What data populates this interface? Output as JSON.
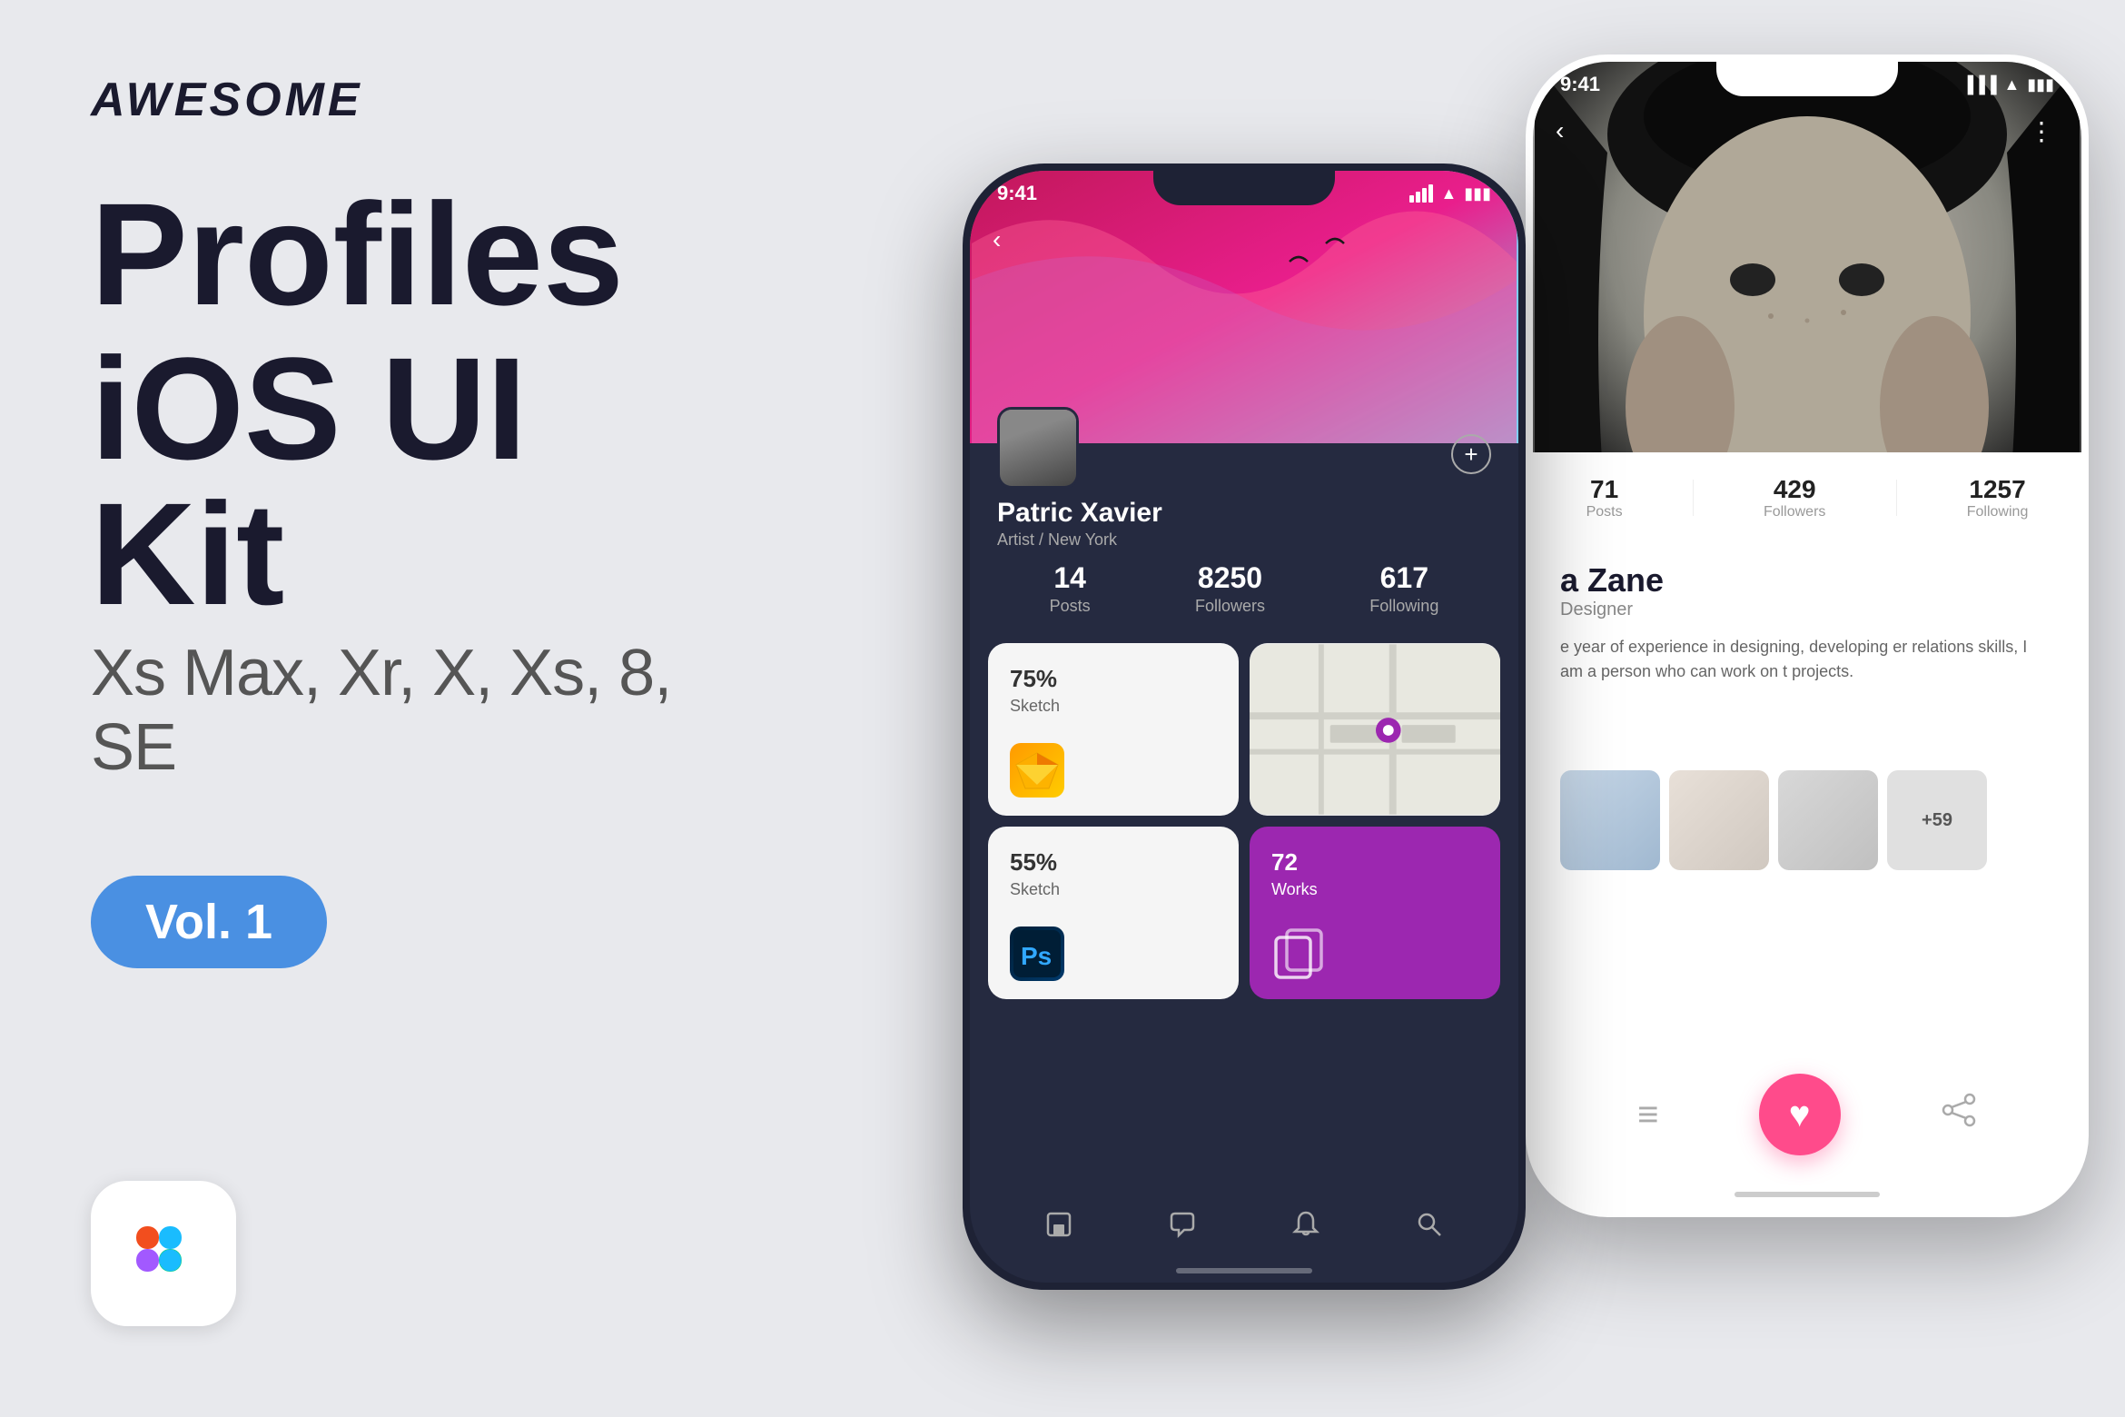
{
  "brand": {
    "name": "AWESOME"
  },
  "title": {
    "line1": "Profiles",
    "line2": "iOS UI Kit"
  },
  "subtitle": "Xs Max, Xr, X, Xs, 8, SE",
  "badge": "Vol. 1",
  "figma_icon": "🎨",
  "dark_phone": {
    "status_time": "9:41",
    "back_button": "‹",
    "profile_name": "Patric Xavier",
    "profile_sub": "Artist / New York",
    "plus_button": "+",
    "stats": [
      {
        "num": "14",
        "label": "Posts"
      },
      {
        "num": "8250",
        "label": "Followers"
      },
      {
        "num": "617",
        "label": "Following"
      }
    ],
    "cards": [
      {
        "percent": "75%",
        "label": "Sketch",
        "type": "sketch"
      },
      {
        "type": "map"
      },
      {
        "percent": "55%",
        "label": "Sketch",
        "type": "ps"
      },
      {
        "num": "72",
        "label": "Works",
        "type": "works"
      }
    ],
    "nav_icons": [
      "⬜",
      "💬",
      "🔔",
      "🔍"
    ]
  },
  "white_phone": {
    "status_time": "9:41",
    "back_button": "‹",
    "more_button": "⋮",
    "stats": [
      {
        "num": "71",
        "label": "Posts"
      },
      {
        "num": "429",
        "label": "Followers"
      },
      {
        "num": "1257",
        "label": "Following"
      }
    ],
    "profile_name": "a Zane",
    "profile_sub": "Designer",
    "profile_bio": "e year of experience in designing, developing er relations skills, I am a person who can work on t projects.",
    "thumb_more_label": "+59",
    "heart_icon": "♥",
    "share_icon": "↗",
    "menu_icon": "≡"
  }
}
